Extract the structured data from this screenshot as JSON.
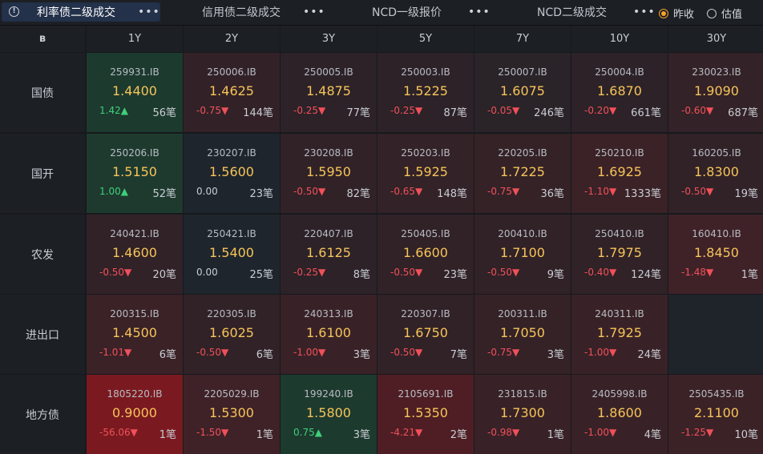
{
  "tabs": [
    {
      "label": "利率债二级成交",
      "active": true
    },
    {
      "label": "信用债二级成交",
      "active": false
    },
    {
      "label": "NCD一级报价",
      "active": false
    },
    {
      "label": "NCD二级成交",
      "active": false
    }
  ],
  "more_label": "•••",
  "radio": [
    {
      "label": "昨收",
      "checked": true
    },
    {
      "label": "估值",
      "checked": false
    }
  ],
  "corner_label": "ʙ",
  "columns": [
    "1Y",
    "2Y",
    "3Y",
    "5Y",
    "7Y",
    "10Y",
    "30Y"
  ],
  "rows": [
    {
      "label": "国债",
      "cells": [
        {
          "code": "259931.IB",
          "yield": "1.4400",
          "change": "1.42▲",
          "dir": "up",
          "count": "56笔",
          "bg": "#1c3a2e"
        },
        {
          "code": "250006.IB",
          "yield": "1.4625",
          "change": "-0.75▼",
          "dir": "down",
          "count": "144笔",
          "bg": "#322227"
        },
        {
          "code": "250005.IB",
          "yield": "1.4875",
          "change": "-0.25▼",
          "dir": "down",
          "count": "77笔",
          "bg": "#2c2228"
        },
        {
          "code": "250003.IB",
          "yield": "1.5225",
          "change": "-0.25▼",
          "dir": "down",
          "count": "87笔",
          "bg": "#2c2228"
        },
        {
          "code": "250007.IB",
          "yield": "1.6075",
          "change": "-0.05▼",
          "dir": "down",
          "count": "246笔",
          "bg": "#2a2328"
        },
        {
          "code": "250004.IB",
          "yield": "1.6870",
          "change": "-0.20▼",
          "dir": "down",
          "count": "661笔",
          "bg": "#2c2228"
        },
        {
          "code": "230023.IB",
          "yield": "1.9090",
          "change": "-0.60▼",
          "dir": "down",
          "count": "687笔",
          "bg": "#332227"
        }
      ]
    },
    {
      "label": "国开",
      "cells": [
        {
          "code": "250206.IB",
          "yield": "1.5150",
          "change": "1.00▲",
          "dir": "up",
          "count": "52笔",
          "bg": "#1e3a2f"
        },
        {
          "code": "230207.IB",
          "yield": "1.5600",
          "change": "0.00",
          "dir": "flat",
          "count": "23笔",
          "bg": "#1f252d"
        },
        {
          "code": "230208.IB",
          "yield": "1.5950",
          "change": "-0.50▼",
          "dir": "down",
          "count": "82笔",
          "bg": "#312227"
        },
        {
          "code": "250203.IB",
          "yield": "1.5925",
          "change": "-0.65▼",
          "dir": "down",
          "count": "148笔",
          "bg": "#332227"
        },
        {
          "code": "220205.IB",
          "yield": "1.7225",
          "change": "-0.75▼",
          "dir": "down",
          "count": "36笔",
          "bg": "#342227"
        },
        {
          "code": "250210.IB",
          "yield": "1.6925",
          "change": "-1.10▼",
          "dir": "down",
          "count": "1333笔",
          "bg": "#3a2227"
        },
        {
          "code": "160205.IB",
          "yield": "1.8300",
          "change": "-0.50▼",
          "dir": "down",
          "count": "19笔",
          "bg": "#312227"
        }
      ]
    },
    {
      "label": "农发",
      "cells": [
        {
          "code": "240421.IB",
          "yield": "1.4600",
          "change": "-0.50▼",
          "dir": "down",
          "count": "20笔",
          "bg": "#312227"
        },
        {
          "code": "250421.IB",
          "yield": "1.5400",
          "change": "0.00",
          "dir": "flat",
          "count": "25笔",
          "bg": "#1f252d"
        },
        {
          "code": "220407.IB",
          "yield": "1.6125",
          "change": "-0.25▼",
          "dir": "down",
          "count": "8笔",
          "bg": "#2c2228"
        },
        {
          "code": "250405.IB",
          "yield": "1.6600",
          "change": "-0.50▼",
          "dir": "down",
          "count": "23笔",
          "bg": "#312227"
        },
        {
          "code": "200410.IB",
          "yield": "1.7100",
          "change": "-0.50▼",
          "dir": "down",
          "count": "9笔",
          "bg": "#312227"
        },
        {
          "code": "250410.IB",
          "yield": "1.7975",
          "change": "-0.40▼",
          "dir": "down",
          "count": "124笔",
          "bg": "#302227"
        },
        {
          "code": "160410.IB",
          "yield": "1.8450",
          "change": "-1.48▼",
          "dir": "down",
          "count": "1笔",
          "bg": "#3f2228"
        }
      ]
    },
    {
      "label": "进出口",
      "cells": [
        {
          "code": "200315.IB",
          "yield": "1.4500",
          "change": "-1.01▼",
          "dir": "down",
          "count": "6笔",
          "bg": "#3a2227"
        },
        {
          "code": "220305.IB",
          "yield": "1.6025",
          "change": "-0.50▼",
          "dir": "down",
          "count": "6笔",
          "bg": "#312227"
        },
        {
          "code": "240313.IB",
          "yield": "1.6100",
          "change": "-1.00▼",
          "dir": "down",
          "count": "3笔",
          "bg": "#392227"
        },
        {
          "code": "220307.IB",
          "yield": "1.6750",
          "change": "-0.50▼",
          "dir": "down",
          "count": "7笔",
          "bg": "#312227"
        },
        {
          "code": "200311.IB",
          "yield": "1.7050",
          "change": "-0.75▼",
          "dir": "down",
          "count": "3笔",
          "bg": "#342227"
        },
        {
          "code": "240311.IB",
          "yield": "1.7925",
          "change": "-1.00▼",
          "dir": "down",
          "count": "24笔",
          "bg": "#392227"
        },
        null
      ]
    },
    {
      "label": "地方债",
      "cells": [
        {
          "code": "1805220.IB",
          "yield": "0.9000",
          "change": "-56.06▼",
          "dir": "down",
          "count": "1笔",
          "bg": "#7a1a20"
        },
        {
          "code": "2205029.IB",
          "yield": "1.5300",
          "change": "-1.50▼",
          "dir": "down",
          "count": "1笔",
          "bg": "#3f2228"
        },
        {
          "code": "199240.IB",
          "yield": "1.5800",
          "change": "0.75▲",
          "dir": "up",
          "count": "3笔",
          "bg": "#1d3a2e"
        },
        {
          "code": "2105691.IB",
          "yield": "1.5350",
          "change": "-4.21▼",
          "dir": "down",
          "count": "2笔",
          "bg": "#4e1e24"
        },
        {
          "code": "231815.IB",
          "yield": "1.7300",
          "change": "-0.98▼",
          "dir": "down",
          "count": "1笔",
          "bg": "#382227"
        },
        {
          "code": "2405998.IB",
          "yield": "1.8600",
          "change": "-1.00▼",
          "dir": "down",
          "count": "4笔",
          "bg": "#392227"
        },
        {
          "code": "2505435.IB",
          "yield": "2.1100",
          "change": "-1.25▼",
          "dir": "down",
          "count": "10笔",
          "bg": "#3b2227"
        }
      ]
    }
  ]
}
